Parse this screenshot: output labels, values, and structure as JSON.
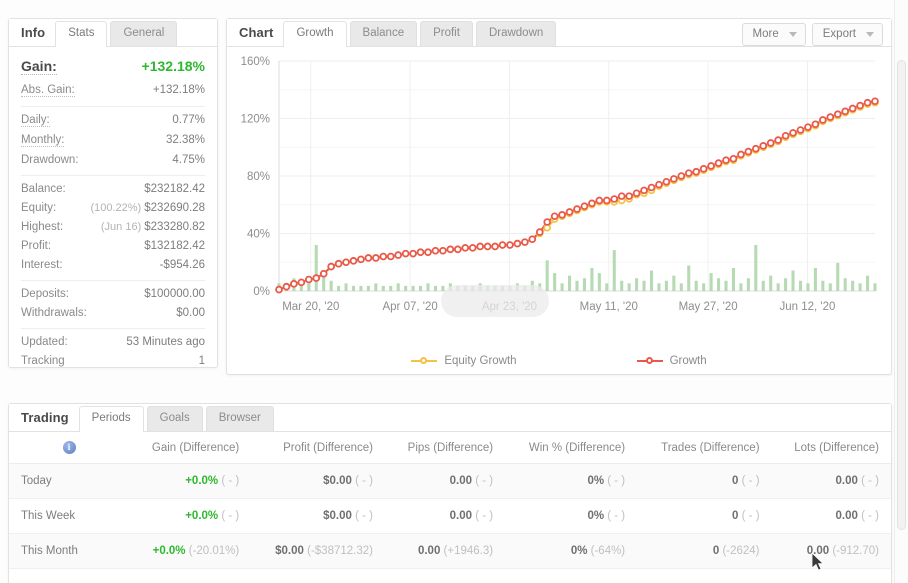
{
  "info": {
    "title": "Info",
    "tabs": [
      {
        "label": "Info",
        "active": false,
        "is_title": true
      },
      {
        "label": "Stats",
        "active": true
      },
      {
        "label": "General",
        "active": false
      }
    ],
    "groups": [
      {
        "rows": [
          {
            "label": "Gain:",
            "value": "+132.18%",
            "big": true,
            "green": true,
            "dotted": true
          },
          {
            "label": "Abs. Gain:",
            "value": "+132.18%",
            "green": true,
            "dotted": true
          }
        ]
      },
      {
        "rows": [
          {
            "label": "Daily:",
            "value": "0.77%",
            "dotted": true
          },
          {
            "label": "Monthly:",
            "value": "32.38%",
            "dotted": true
          },
          {
            "label": "Drawdown:",
            "value": "4.75%",
            "dotted": false
          }
        ]
      },
      {
        "rows": [
          {
            "label": "Balance:",
            "value": "$232182.42",
            "dotted": false
          },
          {
            "label": "Equity:",
            "value": "$232690.28",
            "sub": "(100.22%)",
            "dotted": false
          },
          {
            "label": "Highest:",
            "value": "$233280.82",
            "sub": "(Jun 16)",
            "dotted": false
          },
          {
            "label": "Profit:",
            "value": "$132182.42",
            "green": true,
            "dotted": false
          },
          {
            "label": "Interest:",
            "value": "-$954.26",
            "dotted": false
          }
        ]
      },
      {
        "rows": [
          {
            "label": "Deposits:",
            "value": "$100000.00",
            "dotted": false
          },
          {
            "label": "Withdrawals:",
            "value": "$0.00",
            "dotted": false
          }
        ]
      },
      {
        "rows": [
          {
            "label": "Updated:",
            "value": "53 Minutes ago",
            "dotted": false
          },
          {
            "label": "Tracking",
            "value": "1",
            "dotted": false
          }
        ]
      }
    ]
  },
  "chart_panel": {
    "title": "Chart",
    "tabs": [
      {
        "label": "Growth",
        "active": true
      },
      {
        "label": "Balance",
        "active": false
      },
      {
        "label": "Profit",
        "active": false
      },
      {
        "label": "Drawdown",
        "active": false
      }
    ],
    "actions": [
      {
        "label": "More",
        "icon": "chevron-down-icon"
      },
      {
        "label": "Export",
        "icon": "chevron-down-icon"
      }
    ]
  },
  "chart_data": {
    "type": "line",
    "title": "Growth",
    "xlabel": "",
    "ylabel": "",
    "ylim": [
      0,
      160
    ],
    "yticks": [
      "0%",
      "40%",
      "80%",
      "120%",
      "160%"
    ],
    "ytick_values": [
      0,
      40,
      80,
      120,
      160
    ],
    "grid": true,
    "legend_position": "bottom",
    "xticks": [
      "Mar 20, '20",
      "Apr 07, '20",
      "Apr 23, '20",
      "May 11, '20",
      "May 27, '20",
      "Jun 12, '20"
    ],
    "colors": {
      "growth": "#e8584c",
      "equity_growth": "#f5c343",
      "volume_bars": "#a9d5a6"
    },
    "series": [
      {
        "name": "Growth",
        "color": "#e8584c",
        "values": [
          1,
          3,
          5,
          6,
          8,
          9,
          12,
          17,
          19,
          20,
          21,
          22,
          23,
          23,
          24,
          24,
          25,
          26,
          26,
          27,
          27,
          28,
          28,
          29,
          29,
          30,
          30,
          31,
          31,
          31,
          32,
          32,
          33,
          34,
          36,
          41,
          48,
          52,
          53,
          55,
          57,
          59,
          61,
          63,
          63,
          64,
          66,
          66,
          68,
          70,
          72,
          74,
          76,
          78,
          80,
          82,
          83,
          85,
          87,
          89,
          91,
          92,
          95,
          97,
          99,
          101,
          103,
          105,
          108,
          110,
          112,
          114,
          116,
          119,
          121,
          123,
          125,
          127,
          129,
          131,
          132
        ]
      },
      {
        "name": "Equity Growth",
        "color": "#f5c343",
        "values": [
          1,
          3,
          5,
          6,
          8,
          9,
          12,
          17,
          19,
          20,
          21,
          22,
          23,
          23,
          24,
          24,
          25,
          26,
          26,
          27,
          27,
          28,
          28,
          29,
          29,
          30,
          30,
          31,
          31,
          31,
          32,
          32,
          33,
          34,
          36,
          40,
          44,
          50,
          52,
          54,
          56,
          58,
          60,
          62,
          62,
          62,
          63,
          64,
          67,
          68,
          70,
          73,
          75,
          77,
          79,
          81,
          82,
          84,
          86,
          88,
          90,
          91,
          94,
          96,
          98,
          100,
          102,
          104,
          107,
          109,
          111,
          113,
          115,
          118,
          120,
          122,
          124,
          126,
          128,
          130,
          131
        ]
      }
    ],
    "volume": {
      "name": "Volume",
      "color": "#a9d5a6",
      "values": [
        3,
        2,
        5,
        2,
        3,
        18,
        7,
        4,
        2,
        3,
        2,
        2,
        2,
        3,
        2,
        2,
        3,
        2,
        2,
        2,
        3,
        2,
        2,
        3,
        2,
        2,
        2,
        3,
        2,
        2,
        2,
        2,
        3,
        2,
        4,
        3,
        12,
        7,
        3,
        6,
        4,
        5,
        9,
        7,
        3,
        16,
        4,
        3,
        5,
        4,
        8,
        3,
        4,
        6,
        3,
        10,
        4,
        3,
        7,
        5,
        4,
        9,
        3,
        5,
        18,
        4,
        6,
        3,
        5,
        8,
        4,
        3,
        9,
        4,
        3,
        11,
        5,
        4,
        3,
        6,
        3
      ]
    },
    "legend": [
      {
        "label": "Equity Growth",
        "color": "#f5c343"
      },
      {
        "label": "Growth",
        "color": "#e8584c"
      }
    ]
  },
  "trading": {
    "title": "Trading",
    "tabs": [
      {
        "label": "Periods",
        "active": true
      },
      {
        "label": "Goals",
        "active": false
      },
      {
        "label": "Browser",
        "active": false
      }
    ],
    "columns": [
      {
        "label": "",
        "icon": "info-icon"
      },
      {
        "label": "Gain (Difference)"
      },
      {
        "label": "Profit (Difference)"
      },
      {
        "label": "Pips (Difference)"
      },
      {
        "label": "Win % (Difference)"
      },
      {
        "label": "Trades (Difference)"
      },
      {
        "label": "Lots (Difference)"
      }
    ],
    "rows": [
      {
        "period": "Today",
        "cells": [
          {
            "main": "+0.0%",
            "diff": "( - )",
            "positive": true
          },
          {
            "main": "$0.00",
            "diff": "( - )"
          },
          {
            "main": "0.00",
            "diff": "( - )"
          },
          {
            "main": "0%",
            "diff": "( - )"
          },
          {
            "main": "0",
            "diff": "( - )"
          },
          {
            "main": "0.00",
            "diff": "( - )"
          }
        ]
      },
      {
        "period": "This Week",
        "cells": [
          {
            "main": "+0.0%",
            "diff": "( - )",
            "positive": true
          },
          {
            "main": "$0.00",
            "diff": "( - )"
          },
          {
            "main": "0.00",
            "diff": "( - )"
          },
          {
            "main": "0%",
            "diff": "( - )"
          },
          {
            "main": "0",
            "diff": "( - )"
          },
          {
            "main": "0.00",
            "diff": "( - )"
          }
        ]
      },
      {
        "period": "This Month",
        "cells": [
          {
            "main": "+0.0%",
            "diff": "(-20.01%)",
            "positive": true
          },
          {
            "main": "$0.00",
            "diff": "(-$38712.32)"
          },
          {
            "main": "0.00",
            "diff": "(+1946.3)"
          },
          {
            "main": "0%",
            "diff": "(-64%)"
          },
          {
            "main": "0",
            "diff": "(-2624)"
          },
          {
            "main": "0.00",
            "diff": "(-912.70)"
          }
        ]
      }
    ]
  }
}
